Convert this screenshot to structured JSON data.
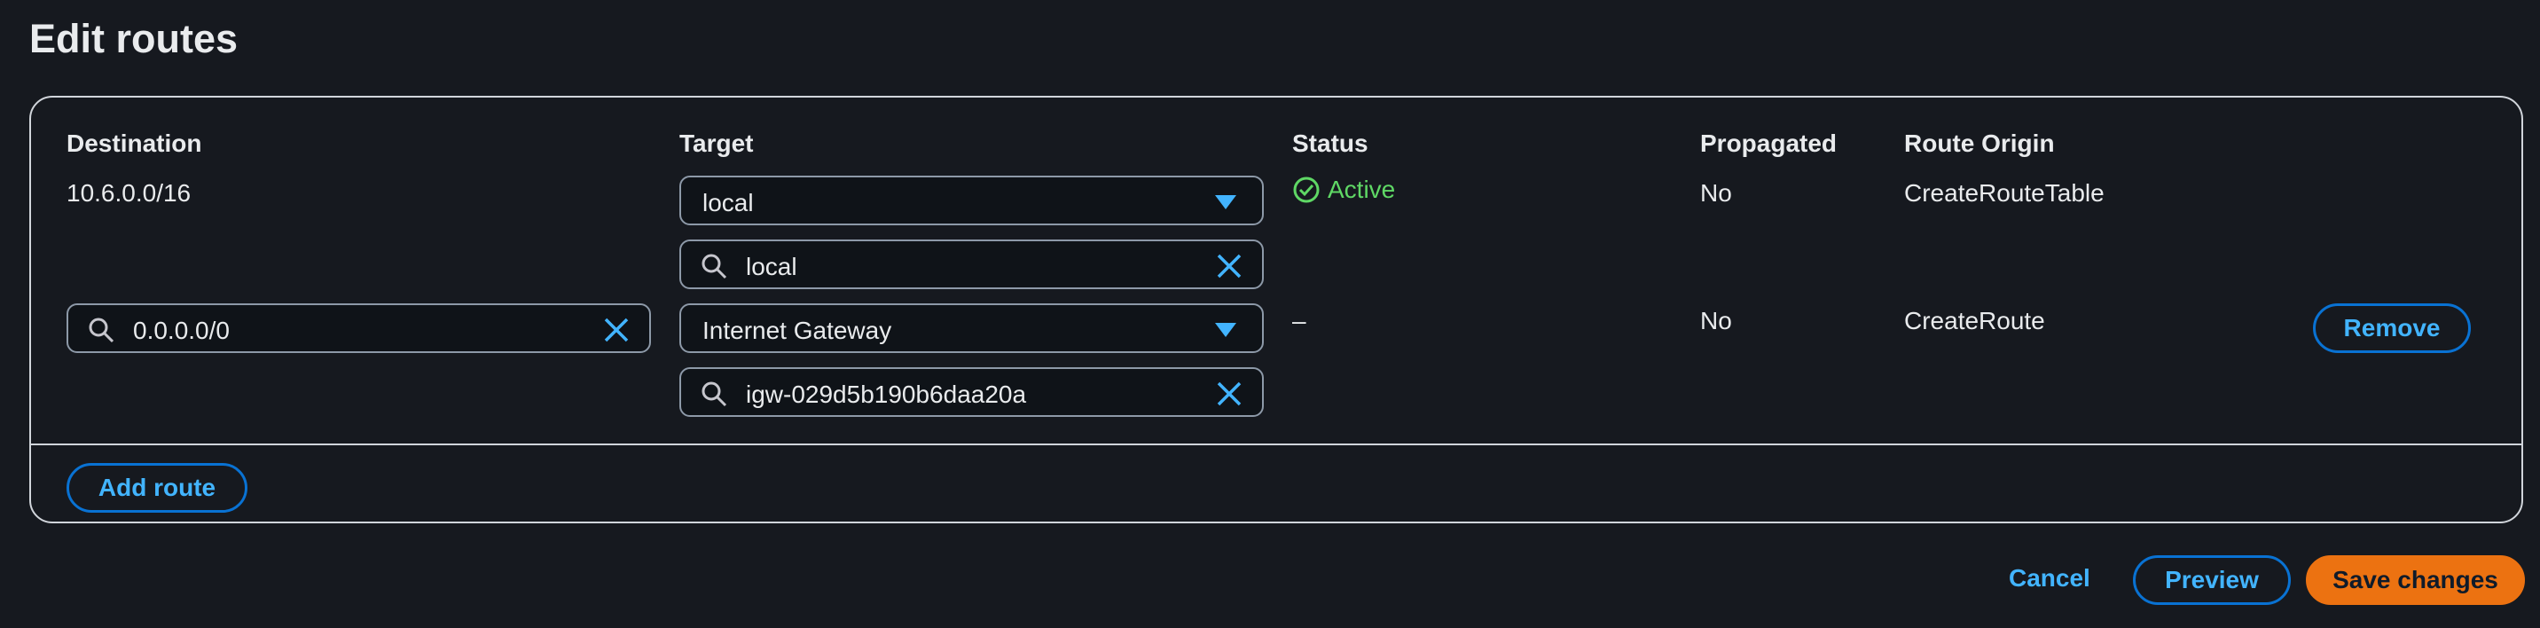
{
  "page": {
    "title": "Edit routes"
  },
  "table": {
    "headers": {
      "destination": "Destination",
      "target": "Target",
      "status": "Status",
      "propagated": "Propagated",
      "route_origin": "Route Origin"
    },
    "rows": [
      {
        "destination": "10.6.0.0/16",
        "target_select": "local",
        "target_search": "local",
        "status": "Active",
        "propagated": "No",
        "route_origin": "CreateRouteTable"
      },
      {
        "destination_search": "0.0.0.0/0",
        "target_select": "Internet Gateway",
        "target_search": "igw-029d5b190b6daa20a",
        "status": "–",
        "propagated": "No",
        "route_origin": "CreateRoute",
        "remove_label": "Remove"
      }
    ]
  },
  "actions": {
    "add_route": "Add route",
    "cancel": "Cancel",
    "preview": "Preview",
    "save": "Save changes"
  },
  "colors": {
    "accent": "#0972d3",
    "link": "#42b4ff",
    "primary": "#ec7211",
    "success": "#5fd865"
  }
}
